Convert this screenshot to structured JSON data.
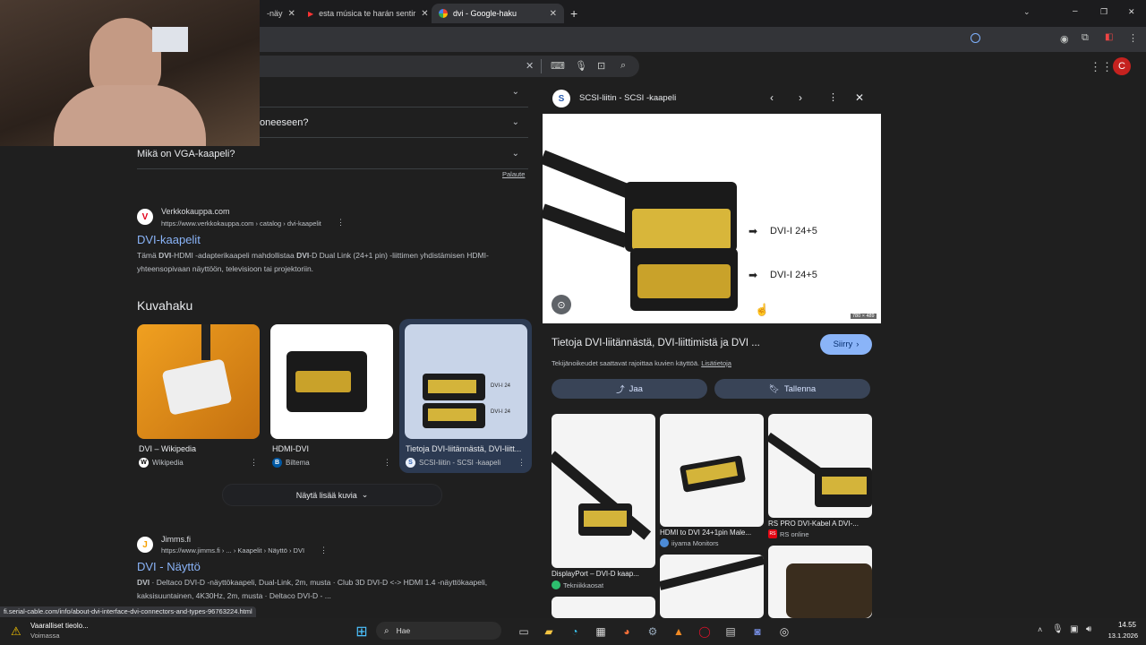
{
  "browser": {
    "tabs": [
      {
        "label": "-näy",
        "active": false
      },
      {
        "label": "esta música te harán sentir",
        "active": false
      },
      {
        "label": "dvi - Google-haku",
        "active": true
      }
    ],
    "new_tab": "+",
    "window_controls": {
      "minimize": "–",
      "restore": "❐",
      "close": "✕"
    }
  },
  "search": {
    "clear": "✕"
  },
  "user_avatar": "C",
  "faq": [
    {
      "label": ""
    },
    {
      "label": "oneeseen?"
    },
    {
      "label": "Mikä on VGA-kaapeli?"
    }
  ],
  "feedback": "Palaute",
  "result1": {
    "site": "Verkkokauppa.com",
    "url": "https://www.verkkokauppa.com › catalog › dvi-kaapelit",
    "title": "DVI-kaapelit",
    "snippet_a": "Tämä ",
    "snippet_b": "DVI",
    "snippet_c": "-HDMI -adapterikaapeli mahdollistaa ",
    "snippet_d": "DVI",
    "snippet_e": "-D Dual Link (24+1 pin) -liittimen yhdistämisen HDMI-yhteensopivaan näyttöön, televisioon tai projektoriin.",
    "favicon": "V"
  },
  "images_section": {
    "heading": "Kuvahaku",
    "cards": [
      {
        "caption": "DVI – Wikipedia",
        "source": "Wikipedia",
        "favicon": "W"
      },
      {
        "caption": "HDMI-DVI",
        "source": "Biltema",
        "favicon": "B"
      },
      {
        "caption": "Tietoja DVI-liitännästä, DVI-liitt...",
        "source": "SCSI-liitin - SCSI -kaapeli",
        "favicon": "S"
      }
    ],
    "more": "Näytä lisää kuvia",
    "overlay_labels": [
      "DVI-I 24",
      "DVI-I 24"
    ]
  },
  "result2": {
    "site": "Jimms.fi",
    "url": "https://www.jimms.fi › ... › Kaapelit › Näyttö › DVI",
    "title": "DVI - Näyttö",
    "snippet_bold": "DVI",
    "snippet": " · Deltaco DVI-D -näyttökaapeli, Dual-Link, 2m, musta · Club 3D DVI-D <-> HDMI 1.4 -näyttökaapeli, kaksisuuntainen, 4K30Hz, 2m, musta · Deltaco DVI-D - ..."
  },
  "panel": {
    "source": "SCSI-liitin - SCSI -kaapeli",
    "image_labels": [
      "DVI-I 24+5",
      "DVI-I 24+5"
    ],
    "image_size": "780 × 489",
    "title": "Tietoja DVI-liitännästä, DVI-liittimistä ja DVI ...",
    "visit": "Siirry",
    "copyright": "Tekijänoikeudet saattavat rajoittaa kuvien käyttöä.",
    "more_info": "Lisätietoja",
    "share": "Jaa",
    "save": "Tallenna",
    "related": [
      {
        "caption": "DisplayPort – DVI-D kaap...",
        "source": "Tekniikkaosat"
      },
      {
        "caption": "HDMI to DVI 24+1pin Male...",
        "source": "iiyama Monitors"
      },
      {
        "caption": "RS PRO DVI-Kabel A DVI-...",
        "source": "RS online"
      }
    ]
  },
  "status_url": "fi.serial-cable.com/info/about-dvi-interface-dvi-connectors-and-types-96763224.html",
  "taskbar": {
    "warning_title": "Vaaralliset tieolo...",
    "warning_sub": "Voimassa",
    "search": "Hae",
    "time": "14.55",
    "date": "13.1.2026"
  }
}
